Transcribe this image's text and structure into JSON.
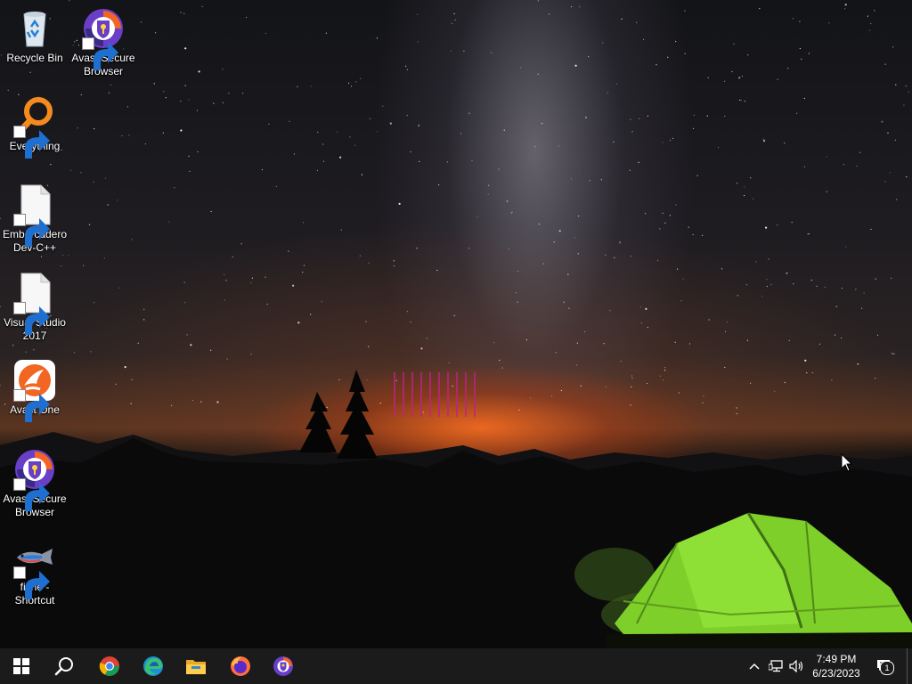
{
  "desktop": {
    "icons": [
      {
        "label": "Recycle Bin",
        "icon": "recycle-bin-icon"
      },
      {
        "label": "Avast Secure\nBrowser",
        "icon": "avast-secure-browser-icon"
      },
      {
        "label": "Everything",
        "icon": "everything-search-icon"
      },
      {
        "label": "Embarcadero\nDev-C++",
        "icon": "blank-file-icon"
      },
      {
        "label": "Visual Studio\n2017",
        "icon": "blank-file-icon"
      },
      {
        "label": "Avast One",
        "icon": "avast-one-icon"
      },
      {
        "label": "Avast Secure\nBrowser",
        "icon": "avast-secure-browser-icon"
      },
      {
        "label": "fishe -\nShortcut",
        "icon": "fish-icon"
      }
    ]
  },
  "taskbar": {
    "start": "windows-start-icon",
    "search": "search-icon",
    "pinned": [
      "chrome-icon",
      "edge-icon",
      "file-explorer-icon",
      "firefox-icon",
      "avast-secure-browser-icon"
    ],
    "tray": [
      "chevron-up-icon",
      "network-icon",
      "volume-icon"
    ],
    "clock": {
      "time": "7:49 PM",
      "date": "6/23/2023"
    },
    "notifications": {
      "count": "1"
    }
  },
  "colors": {
    "taskbar": "#1b1b1b",
    "avast_orange": "#f26522",
    "avast_purple": "#6a3fc8",
    "tent_green": "#8ee02a",
    "glitch_magenta": "#c0208a"
  }
}
